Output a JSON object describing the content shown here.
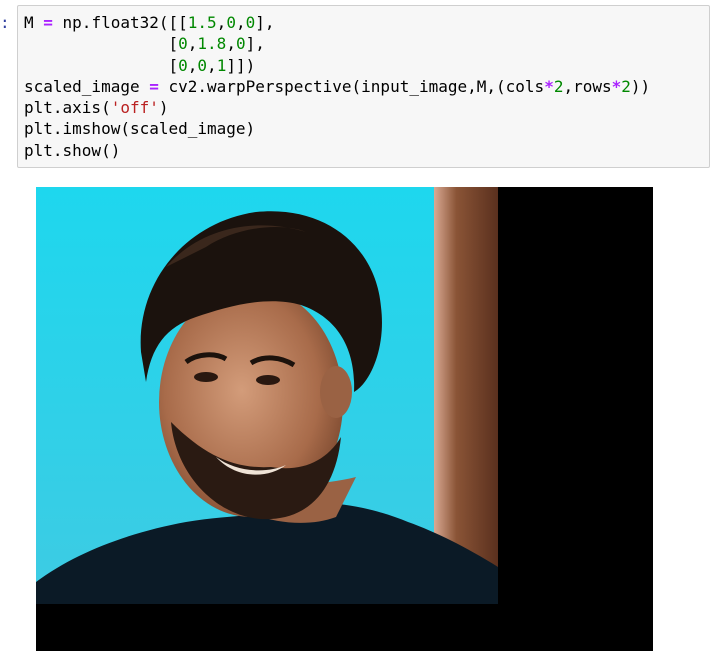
{
  "cell": {
    "prompt": ":",
    "code_lines": [
      [
        {
          "t": "M "
        },
        {
          "t": "=",
          "c": "op"
        },
        {
          "t": " np.float32([["
        },
        {
          "t": "1.5",
          "c": "num"
        },
        {
          "t": ","
        },
        {
          "t": "0",
          "c": "num"
        },
        {
          "t": ","
        },
        {
          "t": "0",
          "c": "num"
        },
        {
          "t": "],"
        }
      ],
      [
        {
          "t": "               ["
        },
        {
          "t": "0",
          "c": "num"
        },
        {
          "t": ","
        },
        {
          "t": "1.8",
          "c": "num"
        },
        {
          "t": ","
        },
        {
          "t": "0",
          "c": "num"
        },
        {
          "t": "],"
        }
      ],
      [
        {
          "t": "               ["
        },
        {
          "t": "0",
          "c": "num"
        },
        {
          "t": ","
        },
        {
          "t": "0",
          "c": "num"
        },
        {
          "t": ","
        },
        {
          "t": "1",
          "c": "num"
        },
        {
          "t": "]])"
        }
      ],
      [
        {
          "t": "scaled_image "
        },
        {
          "t": "=",
          "c": "op"
        },
        {
          "t": " cv2.warpPerspective(input_image,M,(cols"
        },
        {
          "t": "*",
          "c": "op"
        },
        {
          "t": "2",
          "c": "num"
        },
        {
          "t": ",rows"
        },
        {
          "t": "*",
          "c": "op"
        },
        {
          "t": "2",
          "c": "num"
        },
        {
          "t": "))"
        }
      ],
      [
        {
          "t": "plt.axis("
        },
        {
          "t": "'off'",
          "c": "str"
        },
        {
          "t": ")"
        }
      ],
      [
        {
          "t": "plt.imshow(scaled_image)"
        }
      ],
      [
        {
          "t": "plt.show()"
        }
      ]
    ]
  },
  "output": {
    "image_description": "warped-portrait-image",
    "colors": {
      "background": "#000000",
      "sky": "#22d4ea",
      "brown_panel": "#7a4a2c",
      "shirt": "#0c1a24",
      "skin": "#b57a58",
      "hair": "#1c130f"
    }
  }
}
